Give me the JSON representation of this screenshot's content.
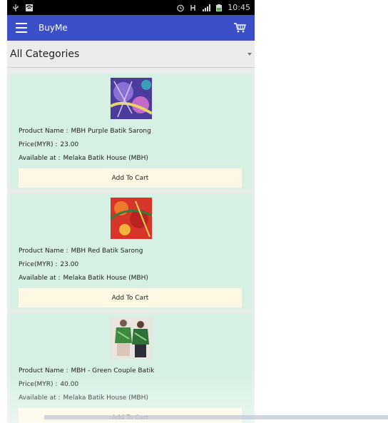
{
  "statusbar": {
    "time": "10:45"
  },
  "appbar": {
    "title": "BuyMe",
    "menu_icon": "hamburger-menu-icon",
    "cart_icon": "shopping-cart-icon"
  },
  "category": {
    "selected": "All Categories"
  },
  "labels": {
    "product_name": "Product Name :",
    "price": "Price(MYR) :",
    "available": "Available at :",
    "add_to_cart": "Add To Cart"
  },
  "products": [
    {
      "name": "MBH Purple Batik Sarong",
      "price": "23.00",
      "location": "Melaka Batik House (MBH)"
    },
    {
      "name": "MBH Red Batik Sarong",
      "price": "23.00",
      "location": "Melaka Batik House (MBH)"
    },
    {
      "name": "MBH - Green Couple Batik",
      "price": "40.00",
      "location": "Melaka Batik House (MBH)"
    }
  ],
  "colors": {
    "appbar": "#3b50c8",
    "card": "#d6f0e3",
    "button": "#fdf7e3"
  }
}
